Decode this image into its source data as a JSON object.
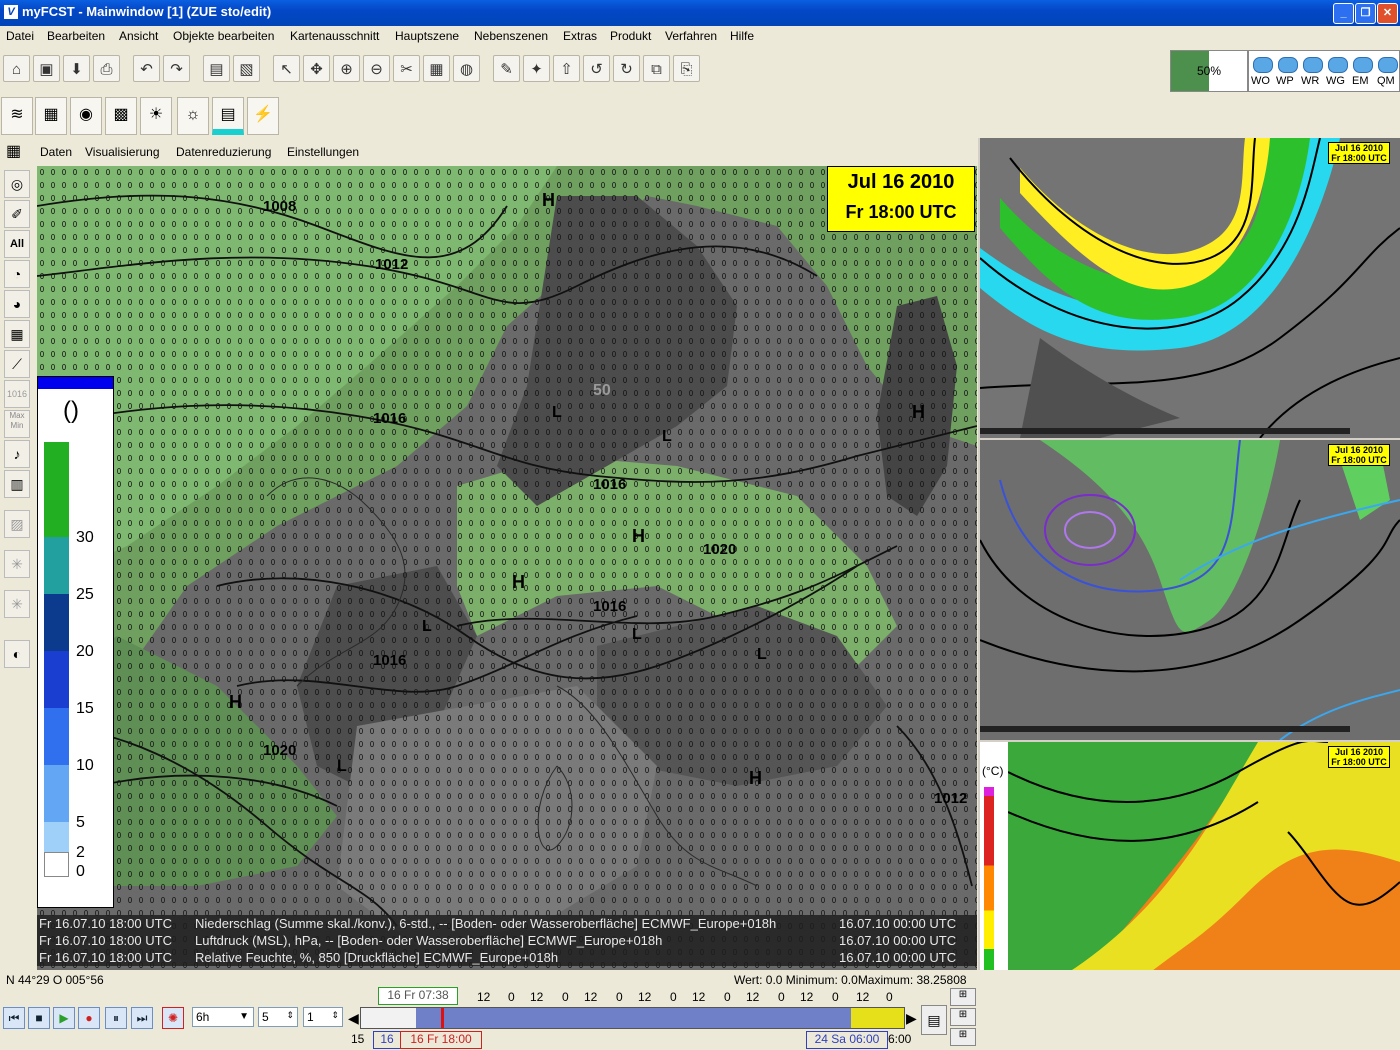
{
  "window": {
    "title": "myFCST - Mainwindow [1] (ZUE sto/edit)",
    "app_icon_letter": "V",
    "controls": [
      "_",
      "❐",
      "✕"
    ]
  },
  "menu": [
    "Datei",
    "Bearbeiten",
    "Ansicht",
    "Objekte bearbeiten",
    "Kartenausschnitt",
    "Hauptszene",
    "Nebenszenen",
    "Extras",
    "Produkt",
    "Verfahren",
    "Hilfe"
  ],
  "toolbar": {
    "progress": {
      "label": "50%",
      "value": 0.5
    },
    "models": [
      "WO",
      "WP",
      "WR",
      "WG",
      "EM",
      "QM"
    ]
  },
  "map_submenu": [
    "Daten",
    "Visualisierung",
    "Datenreduzierung",
    "Einstellungen"
  ],
  "left_tools": {
    "all_label": "All",
    "max_min_label": "Max\nMin",
    "iso_label": "1016"
  },
  "map": {
    "date_line1": "Jul 16 2010",
    "date_line2": "Fr 18:00 UTC",
    "legend": {
      "unit": "()",
      "labels": [
        "30",
        "25",
        "20",
        "15",
        "10",
        "5",
        "2",
        "0"
      ],
      "colors": [
        "#22b022",
        "#22a0a0",
        "#0c3a8c",
        "#1a3fd0",
        "#3070ee",
        "#62a6f4",
        "#9fd0fa",
        "#ffffff"
      ]
    },
    "isobars": [
      "1008",
      "1012",
      "1016",
      "1016",
      "1020",
      "1016",
      "1016",
      "1020",
      "1012"
    ],
    "highs": [
      "H",
      "H",
      "H",
      "H",
      "H",
      "H"
    ],
    "lows": [
      "L",
      "L",
      "L",
      "L",
      "L",
      "L"
    ],
    "rh_value": "50",
    "info_rows": [
      {
        "time": "Fr 16.07.10 18:00 UTC",
        "desc": "Niederschlag (Summe skal./konv.), 6-std., -- [Boden- oder Wasseroberfläche] ECMWF_Europe+018h",
        "run": "16.07.10 00:00 UTC"
      },
      {
        "time": "Fr 16.07.10 18:00 UTC",
        "desc": "Luftdruck (MSL), hPa, -- [Boden- oder Wasseroberfläche] ECMWF_Europe+018h",
        "run": "16.07.10 00:00 UTC"
      },
      {
        "time": "Fr 16.07.10 18:00 UTC",
        "desc": "Relative Feuchte, %, 850 [Druckfläche] ECMWF_Europe+018h",
        "run": "16.07.10 00:00 UTC"
      }
    ]
  },
  "side_panels": {
    "date_line1": "Jul 16 2010",
    "date_line2": "Fr 18:00 UTC",
    "temp_unit": "(°C)"
  },
  "status": {
    "coords": "N 44°29 O 005°56",
    "value_info": "Wert: 0.0 Minimum: 0.0Maximum: 38.25808"
  },
  "timeline": {
    "step_select": "6h",
    "spin1": "5",
    "spin2": "1",
    "start_marker": "16 Fr 07:38",
    "hours": [
      "12",
      "0",
      "12",
      "0",
      "12",
      "0",
      "12",
      "0",
      "12",
      "0",
      "12",
      "0",
      "12",
      "0",
      "12",
      "0"
    ],
    "left_day": "15",
    "day16": "16",
    "current": "16 Fr 18:00",
    "end": "24 Sa 06:00",
    "end_time": "6:00"
  }
}
